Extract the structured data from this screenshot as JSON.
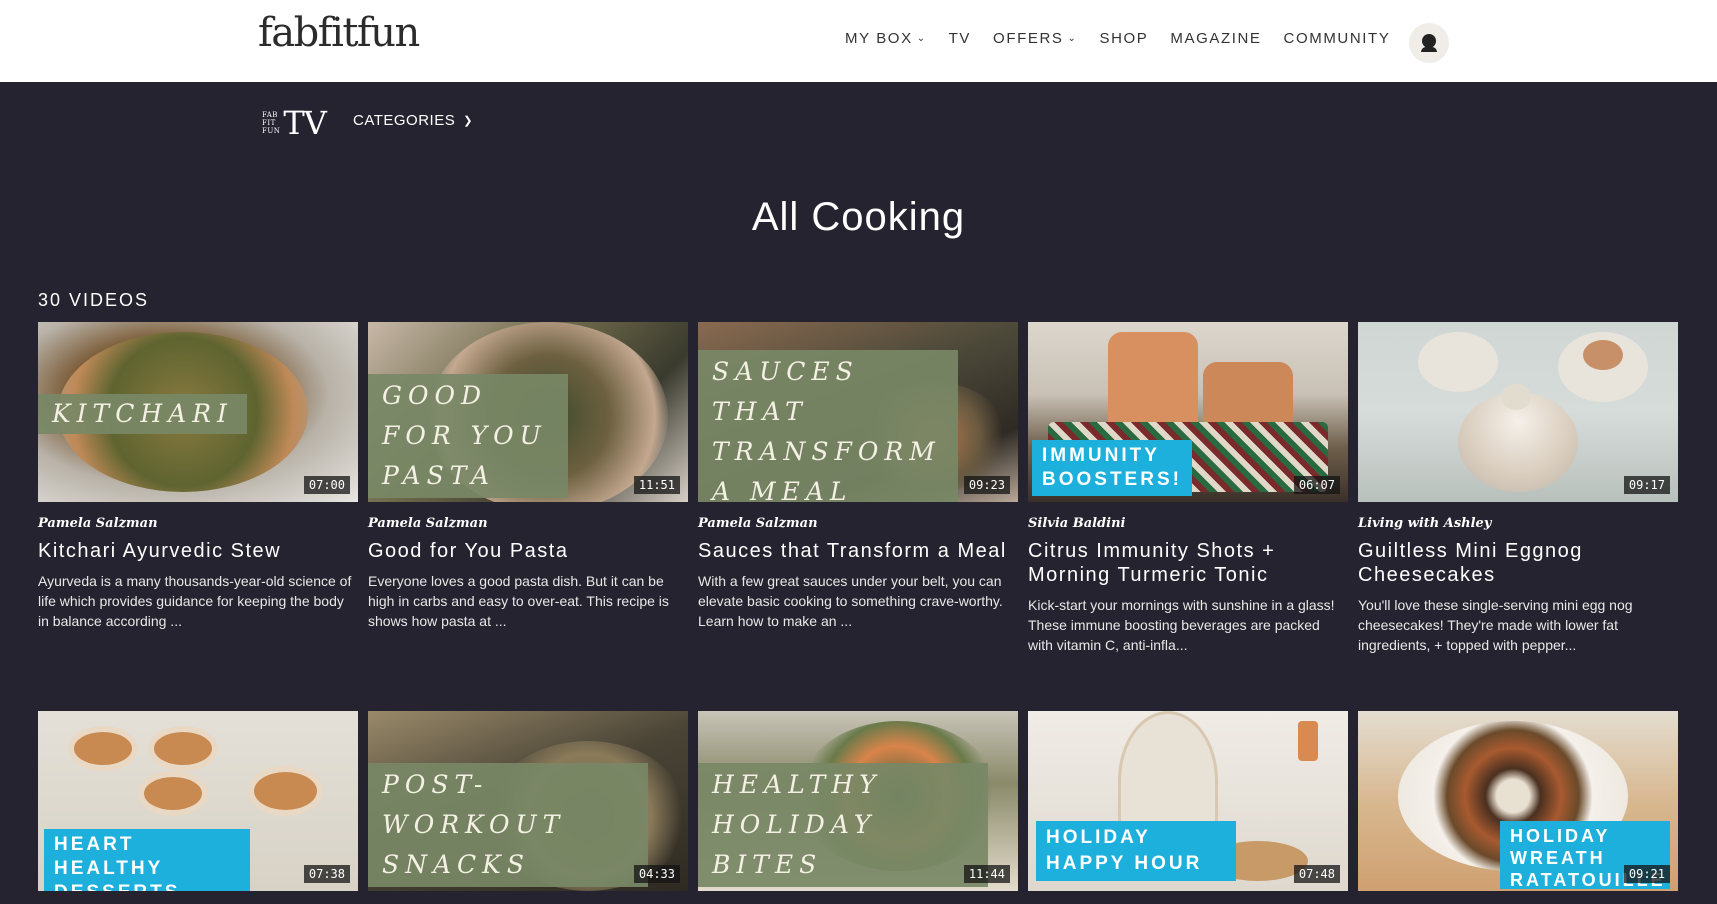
{
  "header": {
    "logo": "fabfitfun",
    "nav": [
      {
        "label": "MY BOX",
        "dropdown": true
      },
      {
        "label": "TV",
        "dropdown": false
      },
      {
        "label": "OFFERS",
        "dropdown": true
      },
      {
        "label": "SHOP",
        "dropdown": false
      },
      {
        "label": "MAGAZINE",
        "dropdown": false
      },
      {
        "label": "COMMUNITY",
        "dropdown": false
      }
    ]
  },
  "subnav": {
    "tv_logo_small": "FAB FIT FUN",
    "tv_logo_big": "TV",
    "categories_label": "CATEGORIES"
  },
  "page": {
    "title": "All Cooking",
    "count": "30 VIDEOS"
  },
  "videos": [
    {
      "overlay": "KITCHARI",
      "overlay_style": "green",
      "duration": "07:00",
      "author": "Pamela Salzman",
      "title": "Kitchari Ayurvedic Stew",
      "description": "Ayurveda is a many thousands-year-old science of life which provides guidance for keeping the body in balance according ..."
    },
    {
      "overlay": "GOOD FOR YOU PASTA",
      "overlay_style": "green",
      "duration": "11:51",
      "author": "Pamela Salzman",
      "title": "Good for You Pasta",
      "description": "Everyone loves a good pasta dish. But it can be high in carbs and easy to over-eat. This recipe is shows how pasta at ..."
    },
    {
      "overlay": "SAUCES THAT TRANSFORM A MEAL",
      "overlay_style": "green",
      "duration": "09:23",
      "author": "Pamela Salzman",
      "title": "Sauces that Transform a Meal",
      "description": "With a few great sauces under your belt, you can elevate basic cooking to something crave-worthy. Learn how to make an ..."
    },
    {
      "overlay": "IMMUNITY BOOSTERS!",
      "overlay_style": "blue",
      "duration": "06:07",
      "author": "Silvia Baldini",
      "title": "Citrus Immunity Shots + Morning Turmeric Tonic",
      "description": "Kick-start your mornings with sunshine in a glass! These immune boosting beverages are packed with vitamin C, anti-infla..."
    },
    {
      "overlay": "",
      "overlay_style": "none",
      "duration": "09:17",
      "author": "Living with Ashley",
      "title": "Guiltless Mini Eggnog Cheesecakes",
      "description": "You'll love these single-serving mini egg nog cheesecakes! They're made with lower fat ingredients, + topped with pepper..."
    },
    {
      "overlay": "HEART HEALTHY DESSERTS",
      "overlay_style": "blue",
      "duration": "07:38"
    },
    {
      "overlay": "POST-WORKOUT SNACKS",
      "overlay_style": "green",
      "duration": "04:33"
    },
    {
      "overlay": "HEALTHY HOLIDAY BITES",
      "overlay_style": "green",
      "duration": "11:44"
    },
    {
      "overlay": "HOLIDAY HAPPY HOUR",
      "overlay_style": "blue",
      "duration": "07:48"
    },
    {
      "overlay": "HOLIDAY WREATH RATATOUILLE",
      "overlay_style": "blue",
      "duration": "09:21"
    }
  ]
}
